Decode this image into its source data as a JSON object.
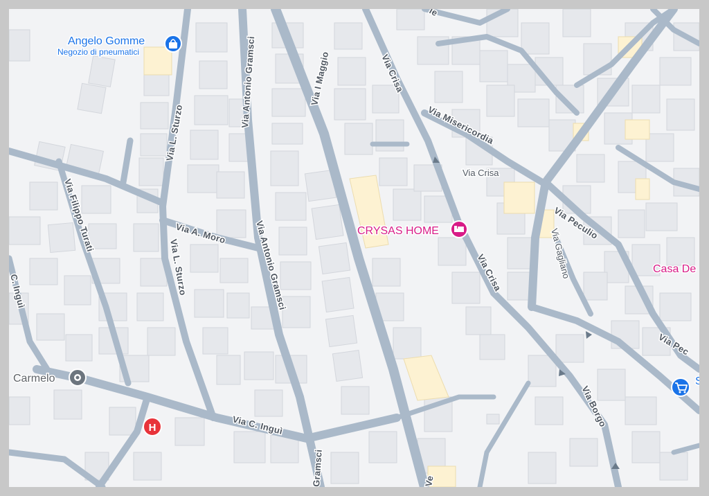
{
  "map": {
    "colors": {
      "background": "#f2f3f5",
      "road": "#aab9c9",
      "building": "#e6e8ec",
      "highlight_building": "#fdf2d2",
      "poi_blue": "#1a73e8",
      "poi_pink": "#d81b87",
      "hospital": "#e8333a"
    },
    "streets": {
      "via_l_sturzo_top": "Via L. Sturzo",
      "via_l_sturzo_bottom": "Via L. Sturzo",
      "via_antonio_gramsci_top": "Via Antonio Gramsci",
      "via_antonio_gramsci_mid": "Via Antonio Gramsci",
      "via_gramsci_bottom": "Gramsci",
      "via_i_maggio": "Via I Maggio",
      "via_crisa_top": "Via Crisa",
      "via_crisa_mid": "Via Crisa",
      "via_crisa_lower": "Via Crisa",
      "via_misericordia": "Via Misericordia",
      "via_peculio": "Via Peculio",
      "via_peculio_2": "Via Pec",
      "via_gagliano": "Via Gagliano",
      "via_borgo": "Via Borgo",
      "via_filippo_turati": "Via Filippo Turati",
      "via_a_moro": "Via A. Moro",
      "via_c_ingui": "Via C. Inguì",
      "via_c_ingui_left": "C. Inguì",
      "via_edge": "Ve",
      "via_top_right": "ie"
    },
    "pois": {
      "angelo_gomme_name": "Angelo Gomme",
      "angelo_gomme_category": "Negozio di pneumatici",
      "crysas_home": "CRYSAS HOME",
      "casa_de": "Casa De",
      "carmelo": "Carmelo",
      "shop_partial": "S",
      "hospital_letter": "H"
    },
    "icons": {
      "shopping_bag": "shopping-bag-icon",
      "hotel_bed": "hotel-bed-icon",
      "place_marker": "place-marker-icon",
      "hospital": "hospital-icon",
      "shopping_cart": "shopping-cart-icon",
      "one_way_arrow": "one-way-arrow-icon"
    }
  }
}
